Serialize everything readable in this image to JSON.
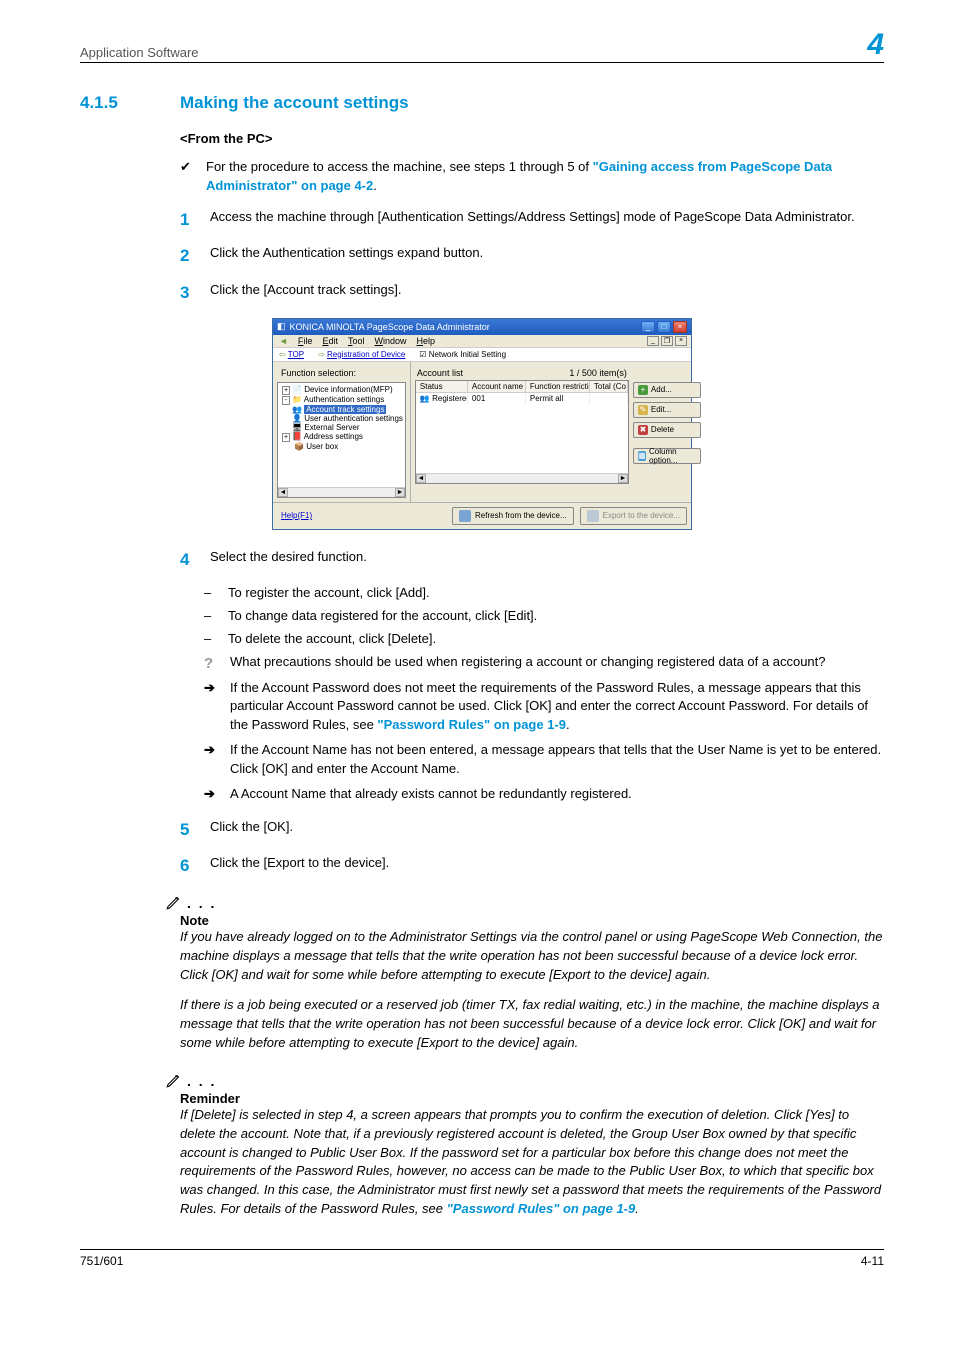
{
  "header": {
    "left": "Application Software",
    "right": "4"
  },
  "section": {
    "num": "4.1.5",
    "title": "Making the account settings"
  },
  "sub1": "<From the PC>",
  "bullet1": {
    "pre": "For the procedure to access the machine, see steps 1 through 5 of ",
    "link": "\"Gaining access from PageScope Data Administrator\" on page 4-2",
    "post": "."
  },
  "steps": {
    "s1": {
      "n": "1",
      "t": "Access the machine through [Authentication Settings/Address Settings] mode of PageScope Data Administrator."
    },
    "s2": {
      "n": "2",
      "t": "Click the Authentication settings expand button."
    },
    "s3": {
      "n": "3",
      "t": "Click the [Account track settings]."
    },
    "s4": {
      "n": "4",
      "t": "Select the desired function."
    },
    "s5": {
      "n": "5",
      "t": "Click the [OK]."
    },
    "s6": {
      "n": "6",
      "t": "Click the [Export to the device]."
    }
  },
  "dashes": {
    "d1": "To register the account, click [Add].",
    "d2": "To change data registered for the account, click [Edit].",
    "d3": "To delete the account, click [Delete]."
  },
  "q1": "What precautions should be used when registering a account or changing registered data of a account?",
  "arrows": {
    "a1": {
      "pre": "If the Account Password does not meet the requirements of the Password Rules, a message appears that this particular Account Password cannot be used. Click [OK] and enter the correct Account Password. For details of the Password Rules, see ",
      "link": "\"Password Rules\" on page 1-9",
      "post": "."
    },
    "a2": "If the Account Name has not been entered, a message appears that tells that the User Name is yet to be entered. Click [OK] and enter the Account Name.",
    "a3": "A Account Name that already exists cannot be redundantly registered."
  },
  "note": {
    "head": "Note",
    "p1": "If you have already logged on to the Administrator Settings via the control panel or using PageScope Web Connection, the machine displays a message that tells that the write operation has not been successful because of a device lock error. Click [OK] and wait for some while before attempting to execute [Export to the device] again.",
    "p2": "If there is a job being executed or a reserved job (timer TX, fax redial waiting, etc.) in the machine, the machine displays a message that tells that the write operation has not been successful because of a device lock error. Click [OK] and wait for some while before attempting to execute [Export to the device] again."
  },
  "reminder": {
    "head": "Reminder",
    "p1_pre": "If [Delete] is selected in step 4, a screen appears that prompts you to confirm the execution of deletion. Click [Yes] to delete the account. Note that, if a previously registered account is deleted, the Group User Box owned by that specific account is changed to Public User Box. If the password set for a particular box before this change does not meet the requirements of the Password Rules, however, no access can be made to the Public User Box, to which that specific box was changed. In this case, the Administrator must first newly set a password that meets the requirements of the Password Rules. For details of the Password Rules, see ",
    "p1_link": "\"Password Rules\" on page 1-9",
    "p1_post": "."
  },
  "footer": {
    "left": "751/601",
    "right": "4-11"
  },
  "shot": {
    "title": "KONICA MINOLTA PageScope Data Administrator",
    "menu": {
      "back": "◄",
      "file": "File",
      "edit": "Edit",
      "tool": "Tool",
      "window": "Window",
      "help": "Help"
    },
    "crumb": {
      "top": "TOP",
      "reg": "Registration of Device",
      "net": "Network Initial Setting"
    },
    "left_head": "Function selection:",
    "tree": {
      "t0": "Device information(MFP)",
      "t1": "Authentication settings",
      "t2": "Account track settings",
      "t3": "User authentication settings",
      "t4": "External Server",
      "t5": "Address settings",
      "t6": "User box"
    },
    "list_head": "Account list",
    "count": "1 / 500 item(s)",
    "cols": {
      "c0": "Status",
      "c1": "Account name",
      "c2": "Function restriction",
      "c3": "Total (Co"
    },
    "row": {
      "r0": "Registered",
      "r1": "001",
      "r2": "Permit all",
      "r3": ""
    },
    "btns": {
      "add": "Add...",
      "edit": "Edit...",
      "del": "Delete",
      "col": "Column option..."
    },
    "help": "Help(F1)",
    "refresh": "Refresh from the device...",
    "export": "Export to the device..."
  }
}
